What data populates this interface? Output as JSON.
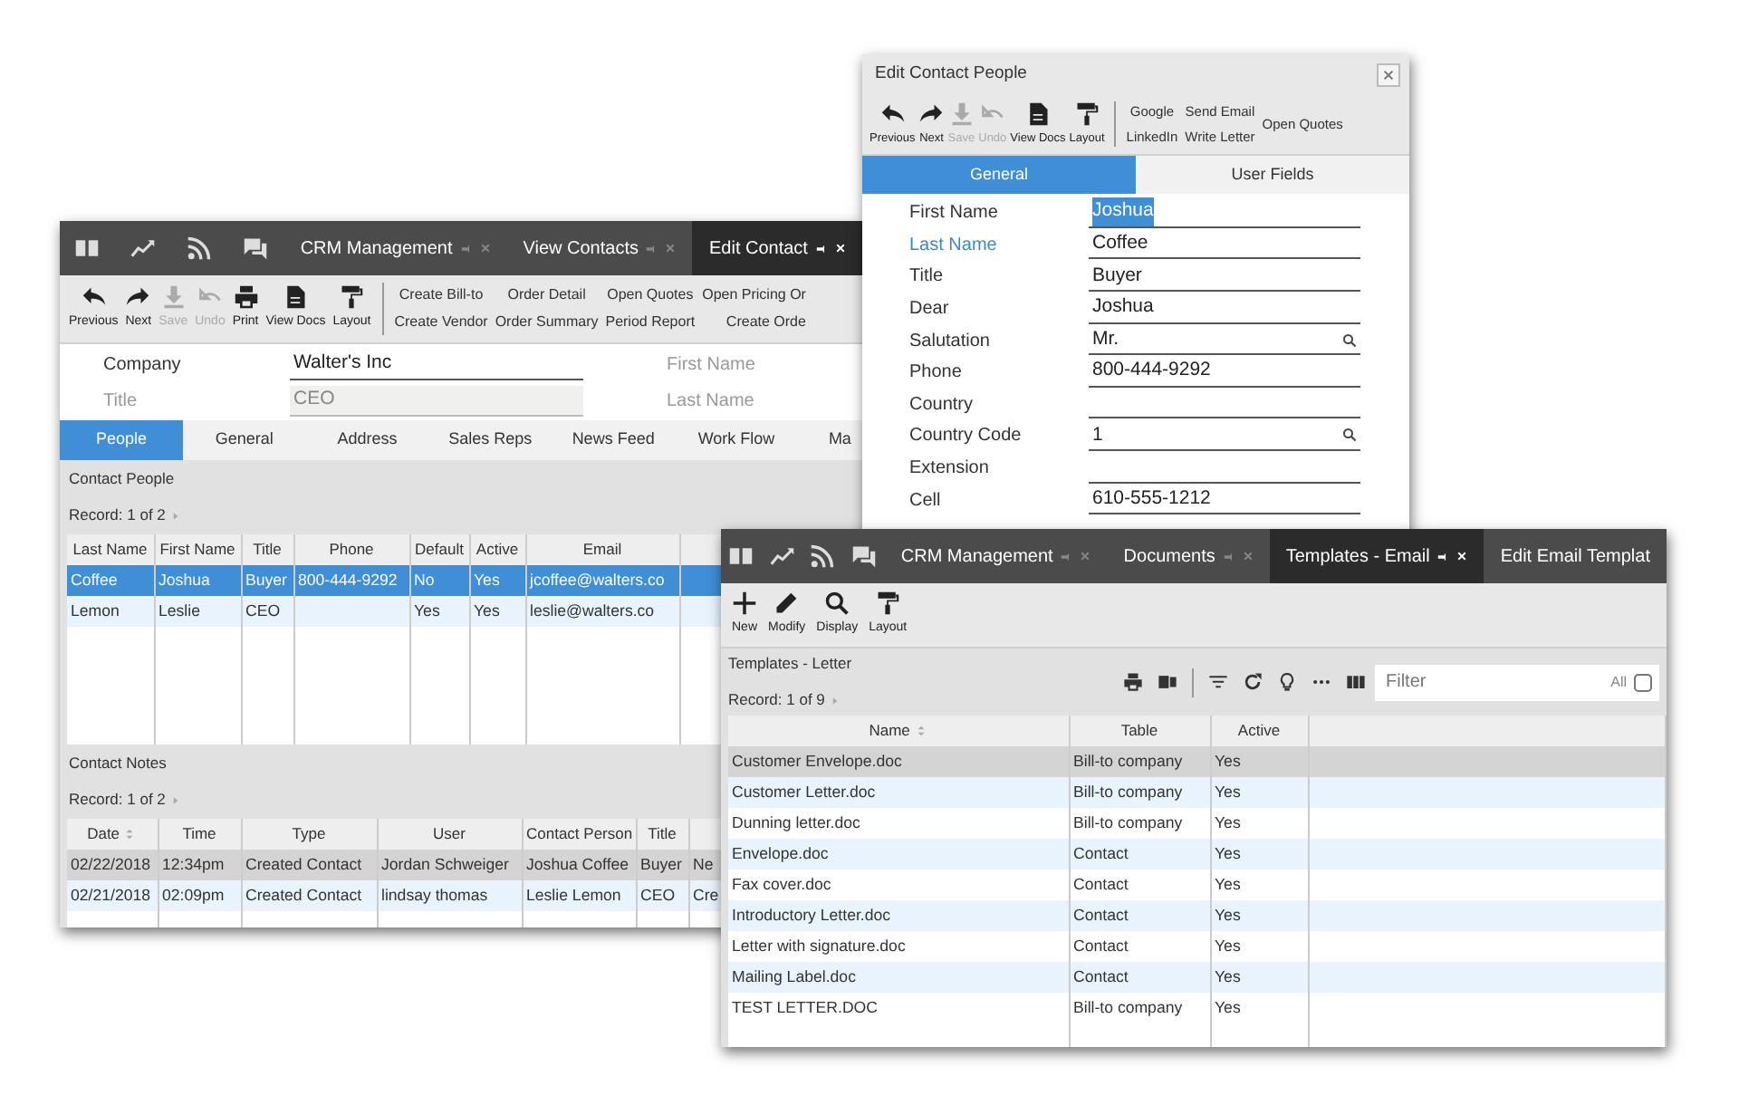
{
  "contact_window": {
    "nav_tabs": [
      {
        "label": "CRM Management",
        "selected": false
      },
      {
        "label": "View Contacts",
        "selected": false
      },
      {
        "label": "Edit Contact",
        "selected": true
      }
    ],
    "toolbar": [
      {
        "label": "Previous",
        "disabled": false
      },
      {
        "label": "Next",
        "disabled": false
      },
      {
        "label": "Save",
        "disabled": true
      },
      {
        "label": "Undo",
        "disabled": true
      },
      {
        "label": "Print",
        "disabled": false
      },
      {
        "label": "View Docs",
        "disabled": false
      },
      {
        "label": "Layout",
        "disabled": false
      }
    ],
    "links": [
      {
        "top": "Create Bill-to",
        "bottom": "Create Vendor"
      },
      {
        "top": "Order Detail",
        "bottom": "Order Summary"
      },
      {
        "top": "Open Quotes",
        "bottom": "Period Report"
      },
      {
        "top": "Open Pricing Or",
        "bottom": "Create Orde"
      }
    ],
    "fields": [
      {
        "label": "Company",
        "value": "Walter's Inc",
        "disabled": false,
        "side_label": "First Name"
      },
      {
        "label": "Title",
        "value": "CEO",
        "disabled": true,
        "side_label": "Last Name"
      }
    ],
    "section_tabs": [
      {
        "label": "People",
        "selected": true
      },
      {
        "label": "General",
        "selected": false
      },
      {
        "label": "Address",
        "selected": false
      },
      {
        "label": "Sales Reps",
        "selected": false
      },
      {
        "label": "News Feed",
        "selected": false
      },
      {
        "label": "Work Flow",
        "selected": false
      },
      {
        "label": "Ma",
        "selected": false
      }
    ],
    "people": {
      "title": "Contact People",
      "record": "Record: 1 of 2",
      "columns": [
        "Last Name",
        "First Name",
        "Title",
        "Phone",
        "Default",
        "Active",
        "Email"
      ],
      "rows": [
        {
          "cells": [
            "Coffee",
            "Joshua",
            "Buyer",
            "800-444-9292",
            "No",
            "Yes",
            "jcoffee@walters.co"
          ],
          "selected": true
        },
        {
          "cells": [
            "Lemon",
            "Leslie",
            "CEO",
            null,
            "Yes",
            "Yes",
            "leslie@walters.co"
          ],
          "selected": false
        }
      ]
    },
    "notes": {
      "title": "Contact Notes",
      "record": "Record: 1 of 2",
      "columns": [
        "Date",
        "Time",
        "Type",
        "User",
        "Contact Person",
        "Title"
      ],
      "rows": [
        {
          "cells": [
            "02/22/2018",
            "12:34pm",
            "Created Contact",
            "Jordan Schweiger",
            "Joshua Coffee",
            "Buyer",
            "Ne"
          ],
          "selected": true
        },
        {
          "cells": [
            "02/21/2018",
            "02:09pm",
            "Created Contact",
            "lindsay thomas",
            "Leslie Lemon",
            "CEO",
            "Cre"
          ],
          "selected": false
        }
      ]
    }
  },
  "contact_dialog": {
    "title": "Edit Contact People",
    "toolbar": [
      {
        "label": "Previous",
        "disabled": false
      },
      {
        "label": "Next",
        "disabled": false
      },
      {
        "label": "Save",
        "disabled": true
      },
      {
        "label": "Undo",
        "disabled": true
      },
      {
        "label": "View Docs",
        "disabled": false
      },
      {
        "label": "Layout",
        "disabled": false
      }
    ],
    "links": [
      {
        "top": "Google",
        "bottom": "LinkedIn"
      },
      {
        "top": "Send Email",
        "bottom": "Write Letter"
      },
      {
        "top": "Open Quotes"
      }
    ],
    "tabs": [
      {
        "label": "General",
        "selected": true
      },
      {
        "label": "User Fields",
        "selected": false
      }
    ],
    "fields": [
      {
        "label": "First Name",
        "value": "Joshua",
        "value_selected": true,
        "label_accent": false,
        "lookup": false
      },
      {
        "label": "Last Name",
        "value": "Coffee",
        "value_selected": false,
        "label_accent": true,
        "lookup": false
      },
      {
        "label": "Title",
        "value": "Buyer",
        "value_selected": false,
        "label_accent": false,
        "lookup": false
      },
      {
        "label": "Dear",
        "value": "Joshua",
        "value_selected": false,
        "label_accent": false,
        "lookup": false
      },
      {
        "label": "Salutation",
        "value": "Mr.",
        "value_selected": false,
        "label_accent": false,
        "lookup": true
      },
      {
        "label": "Phone",
        "value": "800-444-9292",
        "value_selected": false,
        "label_accent": false,
        "lookup": false
      },
      {
        "label": "Country",
        "label_accent": false,
        "lookup": false
      },
      {
        "label": "Country Code",
        "value": "1",
        "value_selected": false,
        "label_accent": false,
        "lookup": true
      },
      {
        "label": "Extension",
        "label_accent": false,
        "lookup": false
      },
      {
        "label": "Cell",
        "value": "610-555-1212",
        "value_selected": false,
        "label_accent": false,
        "lookup": false
      }
    ]
  },
  "templates_window": {
    "nav_tabs": [
      {
        "label": "CRM Management",
        "selected": false
      },
      {
        "label": "Documents",
        "selected": false
      },
      {
        "label": "Templates - Email",
        "selected": true
      },
      {
        "label": "Edit Email Templat",
        "selected": false
      }
    ],
    "toolbar": [
      {
        "label": "New"
      },
      {
        "label": "Modify"
      },
      {
        "label": "Display"
      },
      {
        "label": "Layout"
      }
    ],
    "title": "Templates - Letter",
    "record": "Record: 1 of 9",
    "filter": {
      "placeholder": "Filter"
    },
    "all": {
      "label": "All",
      "checked": false
    },
    "columns": [
      "Name",
      "Table",
      "Active"
    ],
    "rows": [
      {
        "cells": [
          "Customer Envelope.doc",
          "Bill-to company",
          "Yes"
        ],
        "selected": true
      },
      {
        "cells": [
          "Customer Letter.doc",
          "Bill-to company",
          "Yes"
        ],
        "selected": false
      },
      {
        "cells": [
          "Dunning letter.doc",
          "Bill-to company",
          "Yes"
        ],
        "selected": false
      },
      {
        "cells": [
          "Envelope.doc",
          "Contact",
          "Yes"
        ],
        "selected": false
      },
      {
        "cells": [
          "Fax cover.doc",
          "Contact",
          "Yes"
        ],
        "selected": false
      },
      {
        "cells": [
          "Introductory Letter.doc",
          "Contact",
          "Yes"
        ],
        "selected": false
      },
      {
        "cells": [
          "Letter with signature.doc",
          "Contact",
          "Yes"
        ],
        "selected": false
      },
      {
        "cells": [
          "Mailing Label.doc",
          "Contact",
          "Yes"
        ],
        "selected": false
      },
      {
        "cells": [
          "TEST LETTER.DOC",
          "Bill-to company",
          "Yes"
        ],
        "selected": false
      }
    ]
  }
}
